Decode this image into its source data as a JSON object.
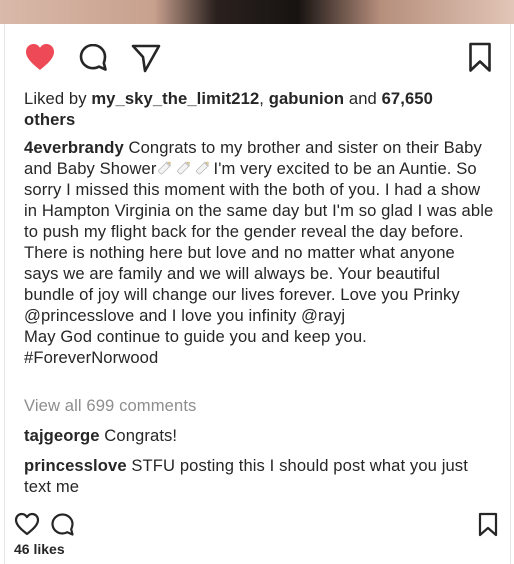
{
  "post": {
    "liked_by_prefix": "Liked by ",
    "liked_user1": "my_sky_the_limit212",
    "liked_sep": ", ",
    "liked_user2": "gabunion",
    "liked_and": " and ",
    "liked_count": "67,650",
    "liked_others": "others",
    "caption_user": "4everbrandy",
    "caption_part1": " Congrats to my brother and sister on their Baby and Baby Shower",
    "caption_emoji": "baby-bottle-icon",
    "caption_part2": "I'm very excited to be an Auntie. So sorry I missed this moment with the both of you. I had a show in Hampton Virginia on the same day but I'm so glad I was able to push my flight back for the gender reveal the day before. There is nothing here but love and no matter what anyone says we are family and we will always be. Your beautiful bundle of joy will change our lives forever. Love you Prinky @princesslove and I love you infinity @rayj",
    "caption_line2": "May God continue to guide you and keep you.",
    "caption_hashtag": "#ForeverNorwood",
    "view_all": "View all 699 comments",
    "comments": [
      {
        "user": "tajgeorge",
        "text": " Congrats!"
      },
      {
        "user": "princesslove",
        "text": " STFU posting this I should post what you just text me"
      }
    ]
  },
  "next_post": {
    "likes": "46 likes"
  },
  "colors": {
    "heart": "#ed4956",
    "text": "#262626",
    "muted": "#8e8e8e"
  },
  "icons": {
    "like": "heart-filled-icon",
    "comment": "comment-bubble-icon",
    "share": "paper-plane-icon",
    "save": "bookmark-icon"
  }
}
